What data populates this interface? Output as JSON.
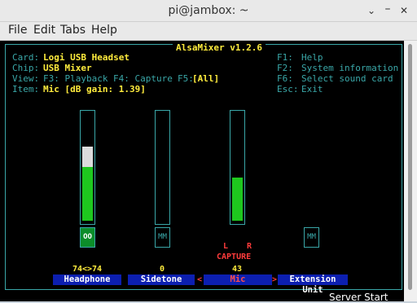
{
  "window": {
    "title": "pi@jambox: ~"
  },
  "menu": [
    "File",
    "Edit",
    "Tabs",
    "Help"
  ],
  "alsamixer": {
    "header": "AlsaMixer v1.2.6",
    "card_label": "Card:",
    "card_value": "Logi USB Headset",
    "chip_label": "Chip:",
    "chip_value": "USB Mixer",
    "view_label": "View:",
    "view_f3": "F3: Playback",
    "view_f4": "F4: Capture",
    "view_f5": "F5:",
    "view_all": "[All]",
    "item_label": "Item:",
    "item_value": "Mic [dB gain: 1.39]",
    "keys": [
      {
        "key": "F1:",
        "action": "Help"
      },
      {
        "key": "F2:",
        "action": "System information"
      },
      {
        "key": "F6:",
        "action": "Select sound card"
      },
      {
        "key": "Esc:",
        "action": "Exit"
      }
    ],
    "controls": [
      {
        "name": "Headphone",
        "value": "74<>74",
        "switch": "OO",
        "level": 0.74,
        "selected": false
      },
      {
        "name": "Sidetone",
        "value": "0",
        "switch": "MM",
        "level": 0,
        "selected": false
      },
      {
        "name": "Mic",
        "value": "43",
        "switch": "",
        "level": 0.43,
        "selected": true
      },
      {
        "name": "Extension Unit",
        "value": "",
        "switch": "MM",
        "selected": false
      }
    ],
    "capture_l": "L",
    "capture_r": "R",
    "capture_label": "CAPTURE",
    "sel_left": "<",
    "sel_right": ">"
  },
  "bottom_text": "Server Start",
  "colors": {
    "cyan": "#3aa7a8",
    "yellow": "#ffec3d",
    "green": "#1ec81e",
    "blue": "#0c1fb0",
    "red": "#ff3b3b"
  }
}
